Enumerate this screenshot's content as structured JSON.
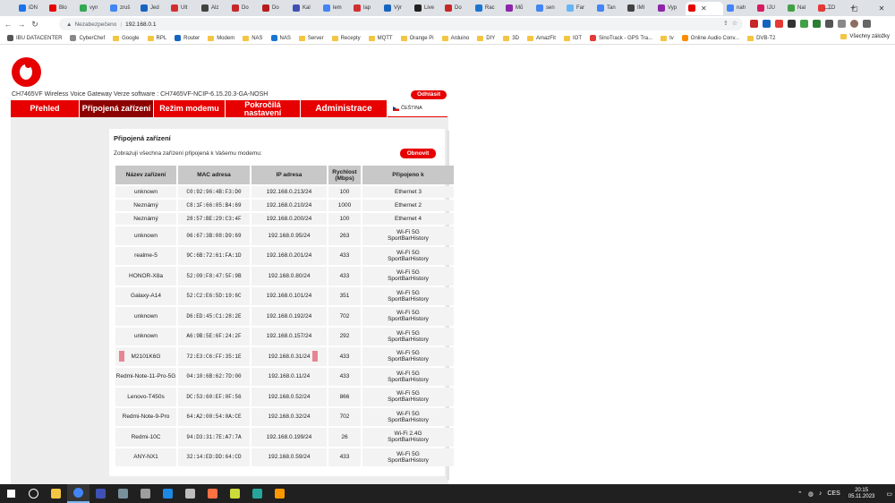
{
  "browser": {
    "tabs": [
      {
        "label": "iDN",
        "color": "#1a73e8"
      },
      {
        "label": "Blo",
        "color": "#e60000"
      },
      {
        "label": "vyn",
        "color": "#34a853"
      },
      {
        "label": "zruš",
        "color": "#4285f4"
      },
      {
        "label": "Jed",
        "color": "#1565c0"
      },
      {
        "label": "Ult",
        "color": "#d32f2f"
      },
      {
        "label": "Alz",
        "color": "#424242"
      },
      {
        "label": "Do",
        "color": "#c62828"
      },
      {
        "label": "Do",
        "color": "#b71c1c"
      },
      {
        "label": "Kal",
        "color": "#3f51b5"
      },
      {
        "label": "lem",
        "color": "#4285f4"
      },
      {
        "label": "lap",
        "color": "#d32f2f"
      },
      {
        "label": "Výr",
        "color": "#1565c0"
      },
      {
        "label": "Live",
        "color": "#212121"
      },
      {
        "label": "Do",
        "color": "#c62828"
      },
      {
        "label": "Rac",
        "color": "#1976d2"
      },
      {
        "label": "Mů",
        "color": "#8e24aa"
      },
      {
        "label": "sen",
        "color": "#4285f4"
      },
      {
        "label": "Far",
        "color": "#64b5f6"
      },
      {
        "label": "Tan",
        "color": "#4285f4"
      },
      {
        "label": "IMI",
        "color": "#424242"
      },
      {
        "label": "Vyp",
        "color": "#8e24aa"
      }
    ],
    "active_tab": {
      "label": "",
      "color": "#e60000"
    },
    "tabs_after": [
      {
        "label": "nah",
        "color": "#4285f4"
      },
      {
        "label": "IJU",
        "color": "#d81b60"
      },
      {
        "label": "Nal",
        "color": "#43a047"
      },
      {
        "label": "TO",
        "color": "#e53935"
      }
    ],
    "new_tab_symbol": "+",
    "address": {
      "security_label": "Nezabezpečeno",
      "url": "192.168.0.1"
    },
    "bookmarks": [
      {
        "label": "IBU DATACENTER",
        "kind": "fav",
        "color": "#555"
      },
      {
        "label": "CyberChef",
        "kind": "fav",
        "color": "#888"
      },
      {
        "label": "Google",
        "kind": "folder"
      },
      {
        "label": "RPL",
        "kind": "folder"
      },
      {
        "label": "Router",
        "kind": "fav",
        "color": "#1565c0"
      },
      {
        "label": "Modem",
        "kind": "folder"
      },
      {
        "label": "NAS",
        "kind": "folder"
      },
      {
        "label": "NAS",
        "kind": "fav",
        "color": "#1976d2"
      },
      {
        "label": "Server",
        "kind": "folder"
      },
      {
        "label": "Recepty",
        "kind": "folder"
      },
      {
        "label": "MQTT",
        "kind": "folder"
      },
      {
        "label": "Orange Pi",
        "kind": "folder"
      },
      {
        "label": "Arduino",
        "kind": "folder"
      },
      {
        "label": "DIY",
        "kind": "folder"
      },
      {
        "label": "3D",
        "kind": "folder"
      },
      {
        "label": "AmazFit",
        "kind": "folder"
      },
      {
        "label": "IOT",
        "kind": "folder"
      },
      {
        "label": "SinoTrack - GPS Tra...",
        "kind": "fav",
        "color": "#e53935"
      },
      {
        "label": "tv",
        "kind": "folder"
      },
      {
        "label": "Online Audio Conv...",
        "kind": "fav",
        "color": "#fb8c00"
      },
      {
        "label": "DVB-T2",
        "kind": "folder"
      }
    ],
    "all_bookmarks_label": "Všechny záložky"
  },
  "router": {
    "model_line": "CH7465VF   Wireless Voice Gateway   Verze software : CH7465VF-NCIP-6.15.20.3-GA-NOSH",
    "logout_label": "Odhlásit",
    "nav": [
      {
        "label": "Přehled",
        "active": false
      },
      {
        "label": "Připojená zařízení",
        "active": true
      },
      {
        "label": "Režim modemu",
        "active": false
      },
      {
        "label": "Pokročilá nastavení",
        "active": false
      },
      {
        "label": "Administrace",
        "active": false
      }
    ],
    "language": "ČEŠTINA",
    "panel_title": "Připojená zařízení",
    "panel_desc": "Zobrazují všechna zařízení připojená k Vašemu modemu:",
    "refresh_label": "Obnovit",
    "columns": [
      "Název zařízení",
      "MAC adresa",
      "IP adresa",
      "Rychlost (Mbps)",
      "Připojeno k"
    ],
    "devices": [
      {
        "name": "unknown",
        "mac": "C0:92:96:4B:F3:D0",
        "ip": "192.168.0.213/24",
        "speed": "100",
        "conn": "Ethernet 3",
        "conn2": "",
        "tall": false
      },
      {
        "name": "Neznámý",
        "mac": "C8:1F:66:05:B4:69",
        "ip": "192.168.0.210/24",
        "speed": "1000",
        "conn": "Ethernet 2",
        "conn2": "",
        "tall": false
      },
      {
        "name": "Neznámý",
        "mac": "28:57:BE:29:C3:4F",
        "ip": "192.168.0.200/24",
        "speed": "100",
        "conn": "Ethernet 4",
        "conn2": "",
        "tall": false
      },
      {
        "name": "unknown",
        "mac": "06:67:3B:08:D9:69",
        "ip": "192.168.0.95/24",
        "speed": "263",
        "conn": "Wi-Fi 5G",
        "conn2": "SportBarHistory",
        "tall": true
      },
      {
        "name": "realme-5",
        "mac": "9C:6B:72:61:FA:1D",
        "ip": "192.168.0.201/24",
        "speed": "433",
        "conn": "Wi-Fi 5G",
        "conn2": "SportBarHistory",
        "tall": true
      },
      {
        "name": "HONOR-X8a",
        "mac": "52:09:F8:47:5F:9B",
        "ip": "192.168.0.80/24",
        "speed": "433",
        "conn": "Wi-Fi 5G",
        "conn2": "SportBarHistory",
        "tall": true
      },
      {
        "name": "Galaxy-A14",
        "mac": "52:C2:E6:5D:19:6C",
        "ip": "192.168.0.101/24",
        "speed": "351",
        "conn": "Wi-Fi 5G",
        "conn2": "SportBarHistory",
        "tall": true
      },
      {
        "name": "unknown",
        "mac": "D6:ED:45:C1:28:2E",
        "ip": "192.168.0.192/24",
        "speed": "702",
        "conn": "Wi-Fi 5G",
        "conn2": "SportBarHistory",
        "tall": true
      },
      {
        "name": "unknown",
        "mac": "A6:9B:5E:6F:24:2F",
        "ip": "192.168.0.157/24",
        "speed": "292",
        "conn": "Wi-Fi 5G",
        "conn2": "SportBarHistory",
        "tall": true
      },
      {
        "name": "M2101K6G",
        "mac": "72:E3:C6:FF:35:1E",
        "ip": "192.168.0.31/24",
        "speed": "433",
        "conn": "Wi-Fi 5G",
        "conn2": "SportBarHistory",
        "tall": true,
        "highlighted": true
      },
      {
        "name": "Redmi-Note-11-Pro-5G",
        "mac": "04:10:6B:62:7D:00",
        "ip": "192.168.0.11/24",
        "speed": "433",
        "conn": "Wi-Fi 5G",
        "conn2": "SportBarHistory",
        "tall": true
      },
      {
        "name": "Lenovo-T450s",
        "mac": "DC:53:60:EF:0F:56",
        "ip": "192.168.0.52/24",
        "speed": "866",
        "conn": "Wi-Fi 5G",
        "conn2": "SportBarHistory",
        "tall": true
      },
      {
        "name": "Redmi-Note-9-Pro",
        "mac": "64:A2:00:54:0A:CE",
        "ip": "192.168.0.32/24",
        "speed": "702",
        "conn": "Wi-Fi 5G",
        "conn2": "SportBarHistory",
        "tall": true
      },
      {
        "name": "Redmi-10C",
        "mac": "94:D3:31:7E:A7:7A",
        "ip": "192.168.0.199/24",
        "speed": "26",
        "conn": "Wi-Fi 2.4G",
        "conn2": "SportBarHistory",
        "tall": true
      },
      {
        "name": "ANY-NX1",
        "mac": "32:14:ED:DD:64:CD",
        "ip": "192.168.0.59/24",
        "speed": "433",
        "conn": "Wi-Fi 5G",
        "conn2": "SportBarHistory",
        "tall": true
      }
    ]
  },
  "taskbar": {
    "apps": [
      {
        "name": "start-button",
        "color": "#ffffff"
      },
      {
        "name": "search-button",
        "color": "#ffffff"
      },
      {
        "name": "file-explorer",
        "color": "#f4c542"
      },
      {
        "name": "chrome",
        "color": "#4285f4",
        "active": true
      },
      {
        "name": "app-1",
        "color": "#3f51b5"
      },
      {
        "name": "app-2",
        "color": "#78909c"
      },
      {
        "name": "app-3",
        "color": "#9e9e9e"
      },
      {
        "name": "app-4",
        "color": "#1e88e5"
      },
      {
        "name": "app-5",
        "color": "#bdbdbd"
      },
      {
        "name": "app-6",
        "color": "#ff7043"
      },
      {
        "name": "app-7",
        "color": "#cddc39"
      },
      {
        "name": "app-8",
        "color": "#26a69a"
      },
      {
        "name": "vlc",
        "color": "#ff9800"
      }
    ],
    "language": "CES",
    "time": "20:15",
    "date": "05.11.2023"
  }
}
